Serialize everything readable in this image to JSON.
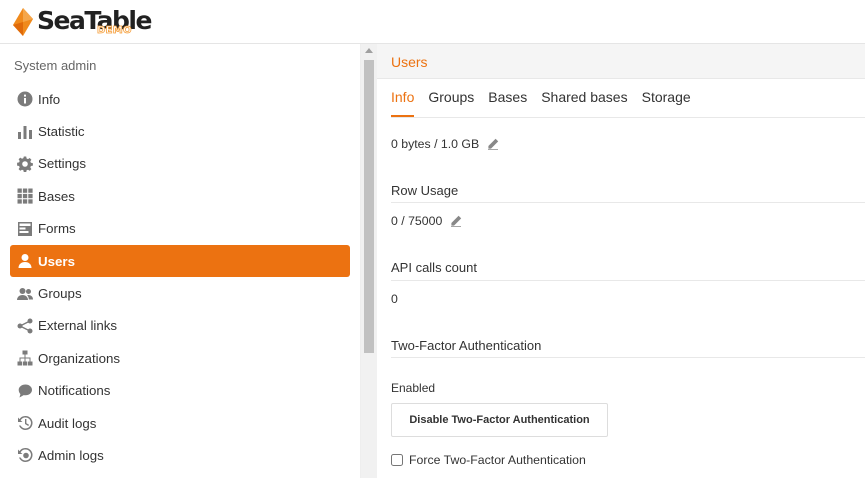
{
  "brand": {
    "name": "SeaTable",
    "badge": "DEMO",
    "accent": "#ec7211"
  },
  "sidebar": {
    "heading": "System admin",
    "items": [
      {
        "label": "Info",
        "icon": "info-icon",
        "active": false
      },
      {
        "label": "Statistic",
        "icon": "bar-chart-icon",
        "active": false
      },
      {
        "label": "Settings",
        "icon": "gear-icon",
        "active": false
      },
      {
        "label": "Bases",
        "icon": "grid-icon",
        "active": false
      },
      {
        "label": "Forms",
        "icon": "form-icon",
        "active": false
      },
      {
        "label": "Users",
        "icon": "user-icon",
        "active": true
      },
      {
        "label": "Groups",
        "icon": "group-icon",
        "active": false
      },
      {
        "label": "External links",
        "icon": "share-icon",
        "active": false
      },
      {
        "label": "Organizations",
        "icon": "org-chart-icon",
        "active": false
      },
      {
        "label": "Notifications",
        "icon": "chat-bubble-icon",
        "active": false
      },
      {
        "label": "Audit logs",
        "icon": "history-icon",
        "active": false
      },
      {
        "label": "Admin logs",
        "icon": "admin-log-icon",
        "active": false
      }
    ]
  },
  "main": {
    "title": "Users",
    "tabs": [
      {
        "label": "Info",
        "active": true
      },
      {
        "label": "Groups",
        "active": false
      },
      {
        "label": "Bases",
        "active": false
      },
      {
        "label": "Shared bases",
        "active": false
      },
      {
        "label": "Storage",
        "active": false
      }
    ],
    "space_usage": {
      "value": "0 bytes / 1.0 GB"
    },
    "row_usage": {
      "title": "Row Usage",
      "value": "0 / 75000"
    },
    "api_calls": {
      "title": "API calls count",
      "value": "0"
    },
    "two_factor": {
      "title": "Two-Factor Authentication",
      "status": "Enabled",
      "button_label": "Disable Two-Factor Authentication",
      "force_label": "Force Two-Factor Authentication",
      "force_checked": false
    }
  }
}
